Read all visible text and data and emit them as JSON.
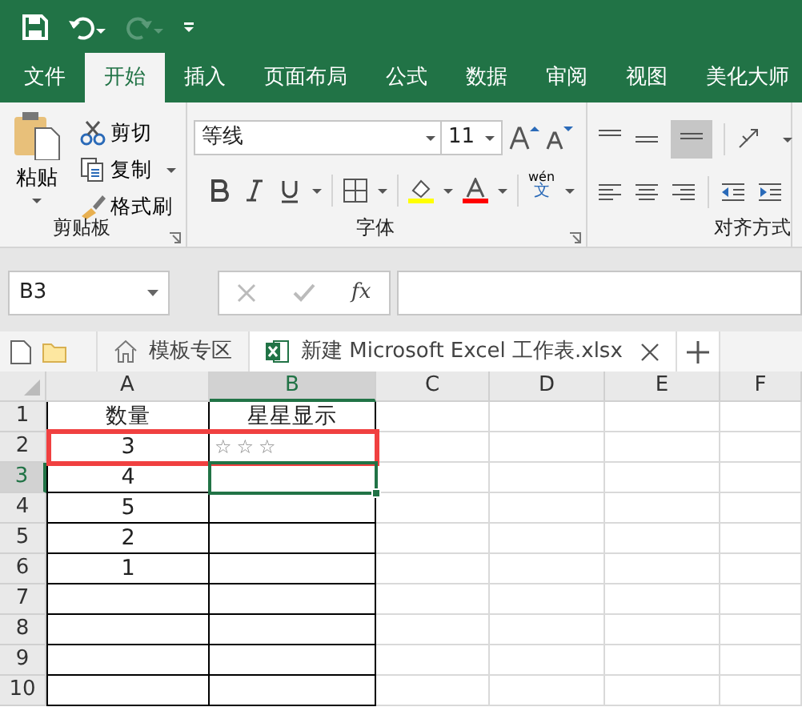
{
  "menu_tabs": [
    {
      "label": "文件",
      "selected": false
    },
    {
      "label": "开始",
      "selected": true
    },
    {
      "label": "插入",
      "selected": false
    },
    {
      "label": "页面布局",
      "selected": false
    },
    {
      "label": "公式",
      "selected": false
    },
    {
      "label": "数据",
      "selected": false
    },
    {
      "label": "审阅",
      "selected": false
    },
    {
      "label": "视图",
      "selected": false
    },
    {
      "label": "美化大师",
      "selected": false
    }
  ],
  "ribbon": {
    "clipboard": {
      "paste": "粘贴",
      "commands": [
        "剪切",
        "复制",
        "格式刷"
      ],
      "label": "剪贴板"
    },
    "font": {
      "font_name": "等线",
      "font_size": "11",
      "phonetic_top": "wén",
      "phonetic_bottom": "文",
      "label": "字体"
    },
    "alignment": {
      "label": "对齐方式"
    }
  },
  "formula_bar": {
    "name_box": "B3",
    "function_label": "fx"
  },
  "file_tabs": [
    {
      "label": "模板专区",
      "kind": "home",
      "selected": false
    },
    {
      "label": "新建 Microsoft Excel 工作表.xlsx",
      "kind": "excel",
      "selected": true
    }
  ],
  "sheet": {
    "columns": [
      {
        "label": "A",
        "selected": false
      },
      {
        "label": "B",
        "selected": true
      },
      {
        "label": "C",
        "selected": false
      },
      {
        "label": "D",
        "selected": false
      },
      {
        "label": "E",
        "selected": false
      },
      {
        "label": "F",
        "selected": false
      }
    ],
    "rows": [
      {
        "number": "1",
        "selected": false,
        "highlighted": false,
        "cells": [
          {
            "text": "数量",
            "selected": false
          },
          {
            "text": "星星显示",
            "selected": false
          }
        ]
      },
      {
        "number": "2",
        "selected": false,
        "highlighted": true,
        "cells": [
          {
            "text": "3",
            "selected": false
          },
          {
            "text": "☆☆☆",
            "kind": "stars",
            "selected": false
          }
        ]
      },
      {
        "number": "3",
        "selected": true,
        "highlighted": false,
        "cells": [
          {
            "text": "4",
            "selected": false
          },
          {
            "selected": true
          }
        ]
      },
      {
        "number": "4",
        "selected": false,
        "highlighted": false,
        "cells": [
          {
            "text": "5",
            "selected": false
          },
          {
            "selected": false
          }
        ]
      },
      {
        "number": "5",
        "selected": false,
        "highlighted": false,
        "cells": [
          {
            "text": "2",
            "selected": false
          },
          {
            "selected": false
          }
        ]
      },
      {
        "number": "6",
        "selected": false,
        "highlighted": false,
        "cells": [
          {
            "text": "1",
            "selected": false
          },
          {
            "selected": false
          }
        ]
      },
      {
        "number": "7",
        "selected": false,
        "highlighted": false,
        "cells": [
          {
            "selected": false
          },
          {
            "selected": false
          }
        ]
      },
      {
        "number": "8",
        "selected": false,
        "highlighted": false,
        "cells": [
          {
            "selected": false
          },
          {
            "selected": false
          }
        ]
      },
      {
        "number": "9",
        "selected": false,
        "highlighted": false,
        "cells": [
          {
            "selected": false
          },
          {
            "selected": false
          }
        ]
      },
      {
        "number": "10",
        "selected": false,
        "highlighted": false,
        "cells": [
          {
            "selected": false
          },
          {
            "selected": false
          }
        ]
      }
    ]
  }
}
